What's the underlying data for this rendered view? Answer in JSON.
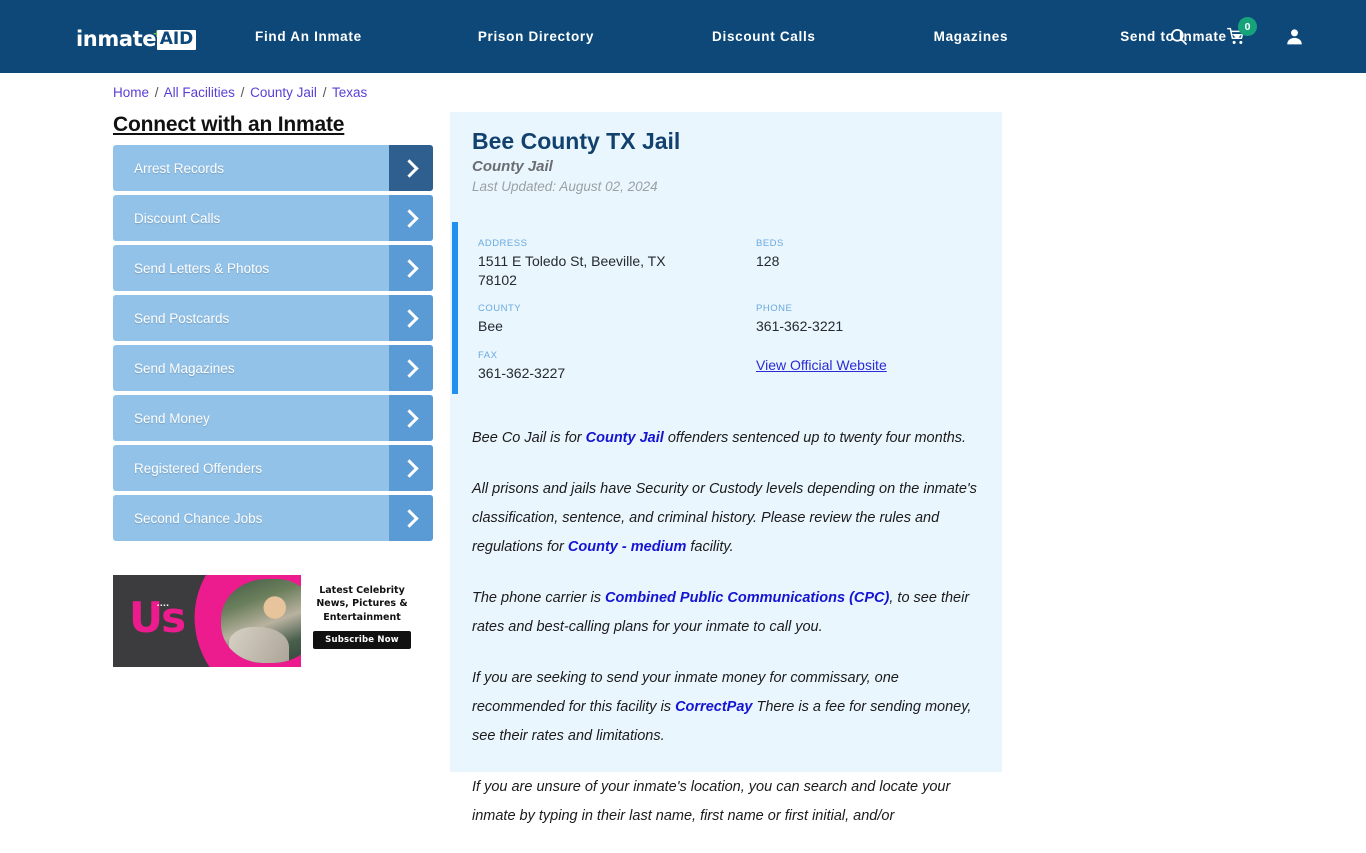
{
  "header": {
    "logo": {
      "word": "inmate",
      "plus": "+",
      "aid": "AID"
    },
    "nav": [
      {
        "label": "Find An Inmate"
      },
      {
        "label": "Prison Directory"
      },
      {
        "label": "Discount Calls"
      },
      {
        "label": "Magazines"
      },
      {
        "label": "Send to Inmate"
      }
    ],
    "icons": {
      "search": "search-icon",
      "cart": "cart-icon",
      "cart_count": "0",
      "account": "user-icon"
    },
    "colors": {
      "bar": "#0d4878",
      "badge": "#16a37b",
      "plus": "#6fbf4a"
    }
  },
  "breadcrumb": {
    "items": [
      "Home",
      "All Facilities",
      "County Jail",
      "Texas"
    ],
    "separator": "/"
  },
  "sidebar": {
    "title": "Connect with an Inmate",
    "items": [
      {
        "label": "Arrest Records",
        "active": true
      },
      {
        "label": "Discount Calls",
        "active": false
      },
      {
        "label": "Send Letters & Photos",
        "active": false
      },
      {
        "label": "Send Postcards",
        "active": false
      },
      {
        "label": "Send Magazines",
        "active": false
      },
      {
        "label": "Send Money",
        "active": false
      },
      {
        "label": "Registered Offenders",
        "active": false
      },
      {
        "label": "Second Chance Jobs",
        "active": false
      }
    ]
  },
  "ad": {
    "brand": "Us",
    "dots": "▪▪▪▪",
    "text": "Latest Celebrity News, Pictures & Entertainment",
    "button": "Subscribe Now"
  },
  "facility": {
    "title": "Bee County TX Jail",
    "subtitle": "County Jail",
    "last_updated": "Last Updated: August 02, 2024",
    "fields": {
      "address_label": "ADDRESS",
      "address_value": "1511 E Toledo St, Beeville, TX 78102",
      "beds_label": "BEDS",
      "beds_value": "128",
      "county_label": "COUNTY",
      "county_value": "Bee",
      "phone_label": "PHONE",
      "phone_value": "361-362-3221",
      "fax_label": "FAX",
      "fax_value": "361-362-3227",
      "website_link": "View Official Website"
    }
  },
  "body": {
    "p1_a": "Bee Co Jail is for ",
    "p1_b": "County Jail",
    "p1_c": " offenders sentenced up to twenty four months.",
    "p2_a": "All prisons and jails have Security or Custody levels depending on the inmate's classification, sentence, and criminal history. Please review the rules and regulations for ",
    "p2_b": "County - medium",
    "p2_c": " facility.",
    "p3_a": "The phone carrier is ",
    "p3_b": "Combined Public Communications (CPC)",
    "p3_c": ", to see their rates and best-calling plans for your inmate to call you.",
    "p4_a": "If you are seeking to send your inmate money for commissary, one recommended for this facility is ",
    "p4_b": "CorrectPay",
    "p4_c": " There is a fee for sending money, see their rates and limitations.",
    "p5_a": "If you are unsure of your inmate's location, you can search and locate your inmate by typing in their last name, first name or first initial, and/or"
  }
}
